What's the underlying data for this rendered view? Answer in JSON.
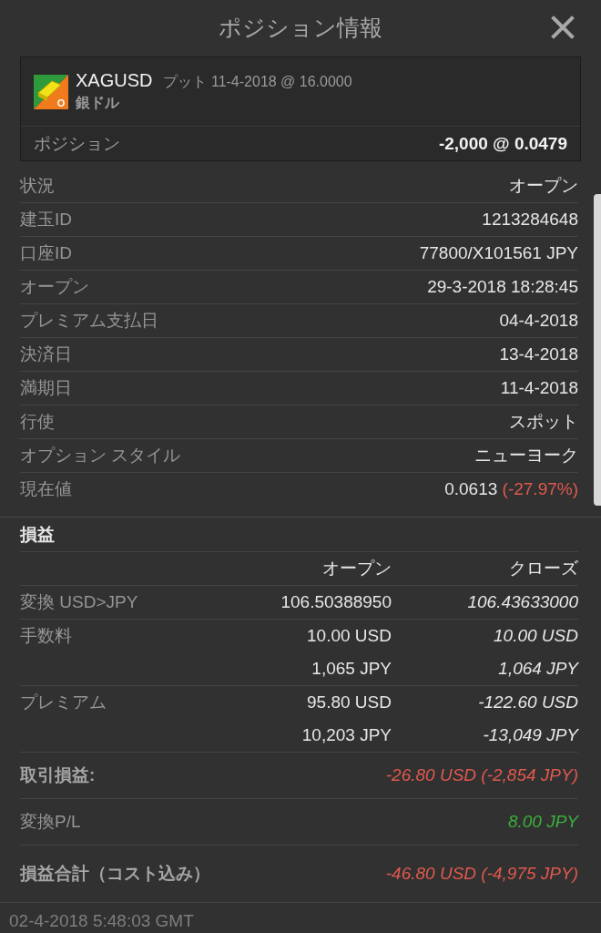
{
  "title": "ポジション情報",
  "header": {
    "icon_letter": "O",
    "symbol": "XAGUSD",
    "option": "プット 11-4-2018 @ 16.0000",
    "name": "銀ドル",
    "position_label": "ポジション",
    "position_value": "-2,000 @ 0.0479"
  },
  "details": [
    {
      "label": "状況",
      "value": "オープン"
    },
    {
      "label": "建玉ID",
      "value": "1213284648"
    },
    {
      "label": "口座ID",
      "value": "77800/X101561 JPY"
    },
    {
      "label": "オープン",
      "value": "29-3-2018 18:28:45"
    },
    {
      "label": "プレミアム支払日",
      "value": "04-4-2018"
    },
    {
      "label": "決済日",
      "value": "13-4-2018"
    },
    {
      "label": "満期日",
      "value": "11-4-2018"
    },
    {
      "label": "行使",
      "value": "スポット"
    },
    {
      "label": "オプション スタイル",
      "value": "ニューヨーク"
    },
    {
      "label": "現在値",
      "value": "0.0613",
      "change": "(-27.97%)"
    }
  ],
  "pnl": {
    "title": "損益",
    "columns": [
      "オープン",
      "クローズ"
    ],
    "rows": [
      {
        "label": "変換 USD>JPY",
        "lines": [
          {
            "open": "106.50388950",
            "close": "106.43633000"
          }
        ]
      },
      {
        "label": "手数料",
        "lines": [
          {
            "open": "10.00 USD",
            "close": "10.00 USD"
          },
          {
            "open": "1,065 JPY",
            "close": "1,064 JPY"
          }
        ]
      },
      {
        "label": "プレミアム",
        "lines": [
          {
            "open": "95.80 USD",
            "close": "-122.60 USD"
          },
          {
            "open": "10,203 JPY",
            "close": "-13,049 JPY"
          }
        ]
      }
    ]
  },
  "summary": [
    {
      "label": "取引損益:",
      "value": "-26.80 USD (-2,854 JPY)",
      "bold": true,
      "color": "#e0594e"
    },
    {
      "label": "変換P/L",
      "value": "8.00 JPY",
      "bold": false,
      "color": "#3cae3c"
    },
    {
      "label": "損益合計（コスト込み）",
      "value": "-46.80 USD (-4,975 JPY)",
      "bold": true,
      "color": "#e0594e"
    }
  ],
  "footer": "02-4-2018 5:48:03 GMT"
}
